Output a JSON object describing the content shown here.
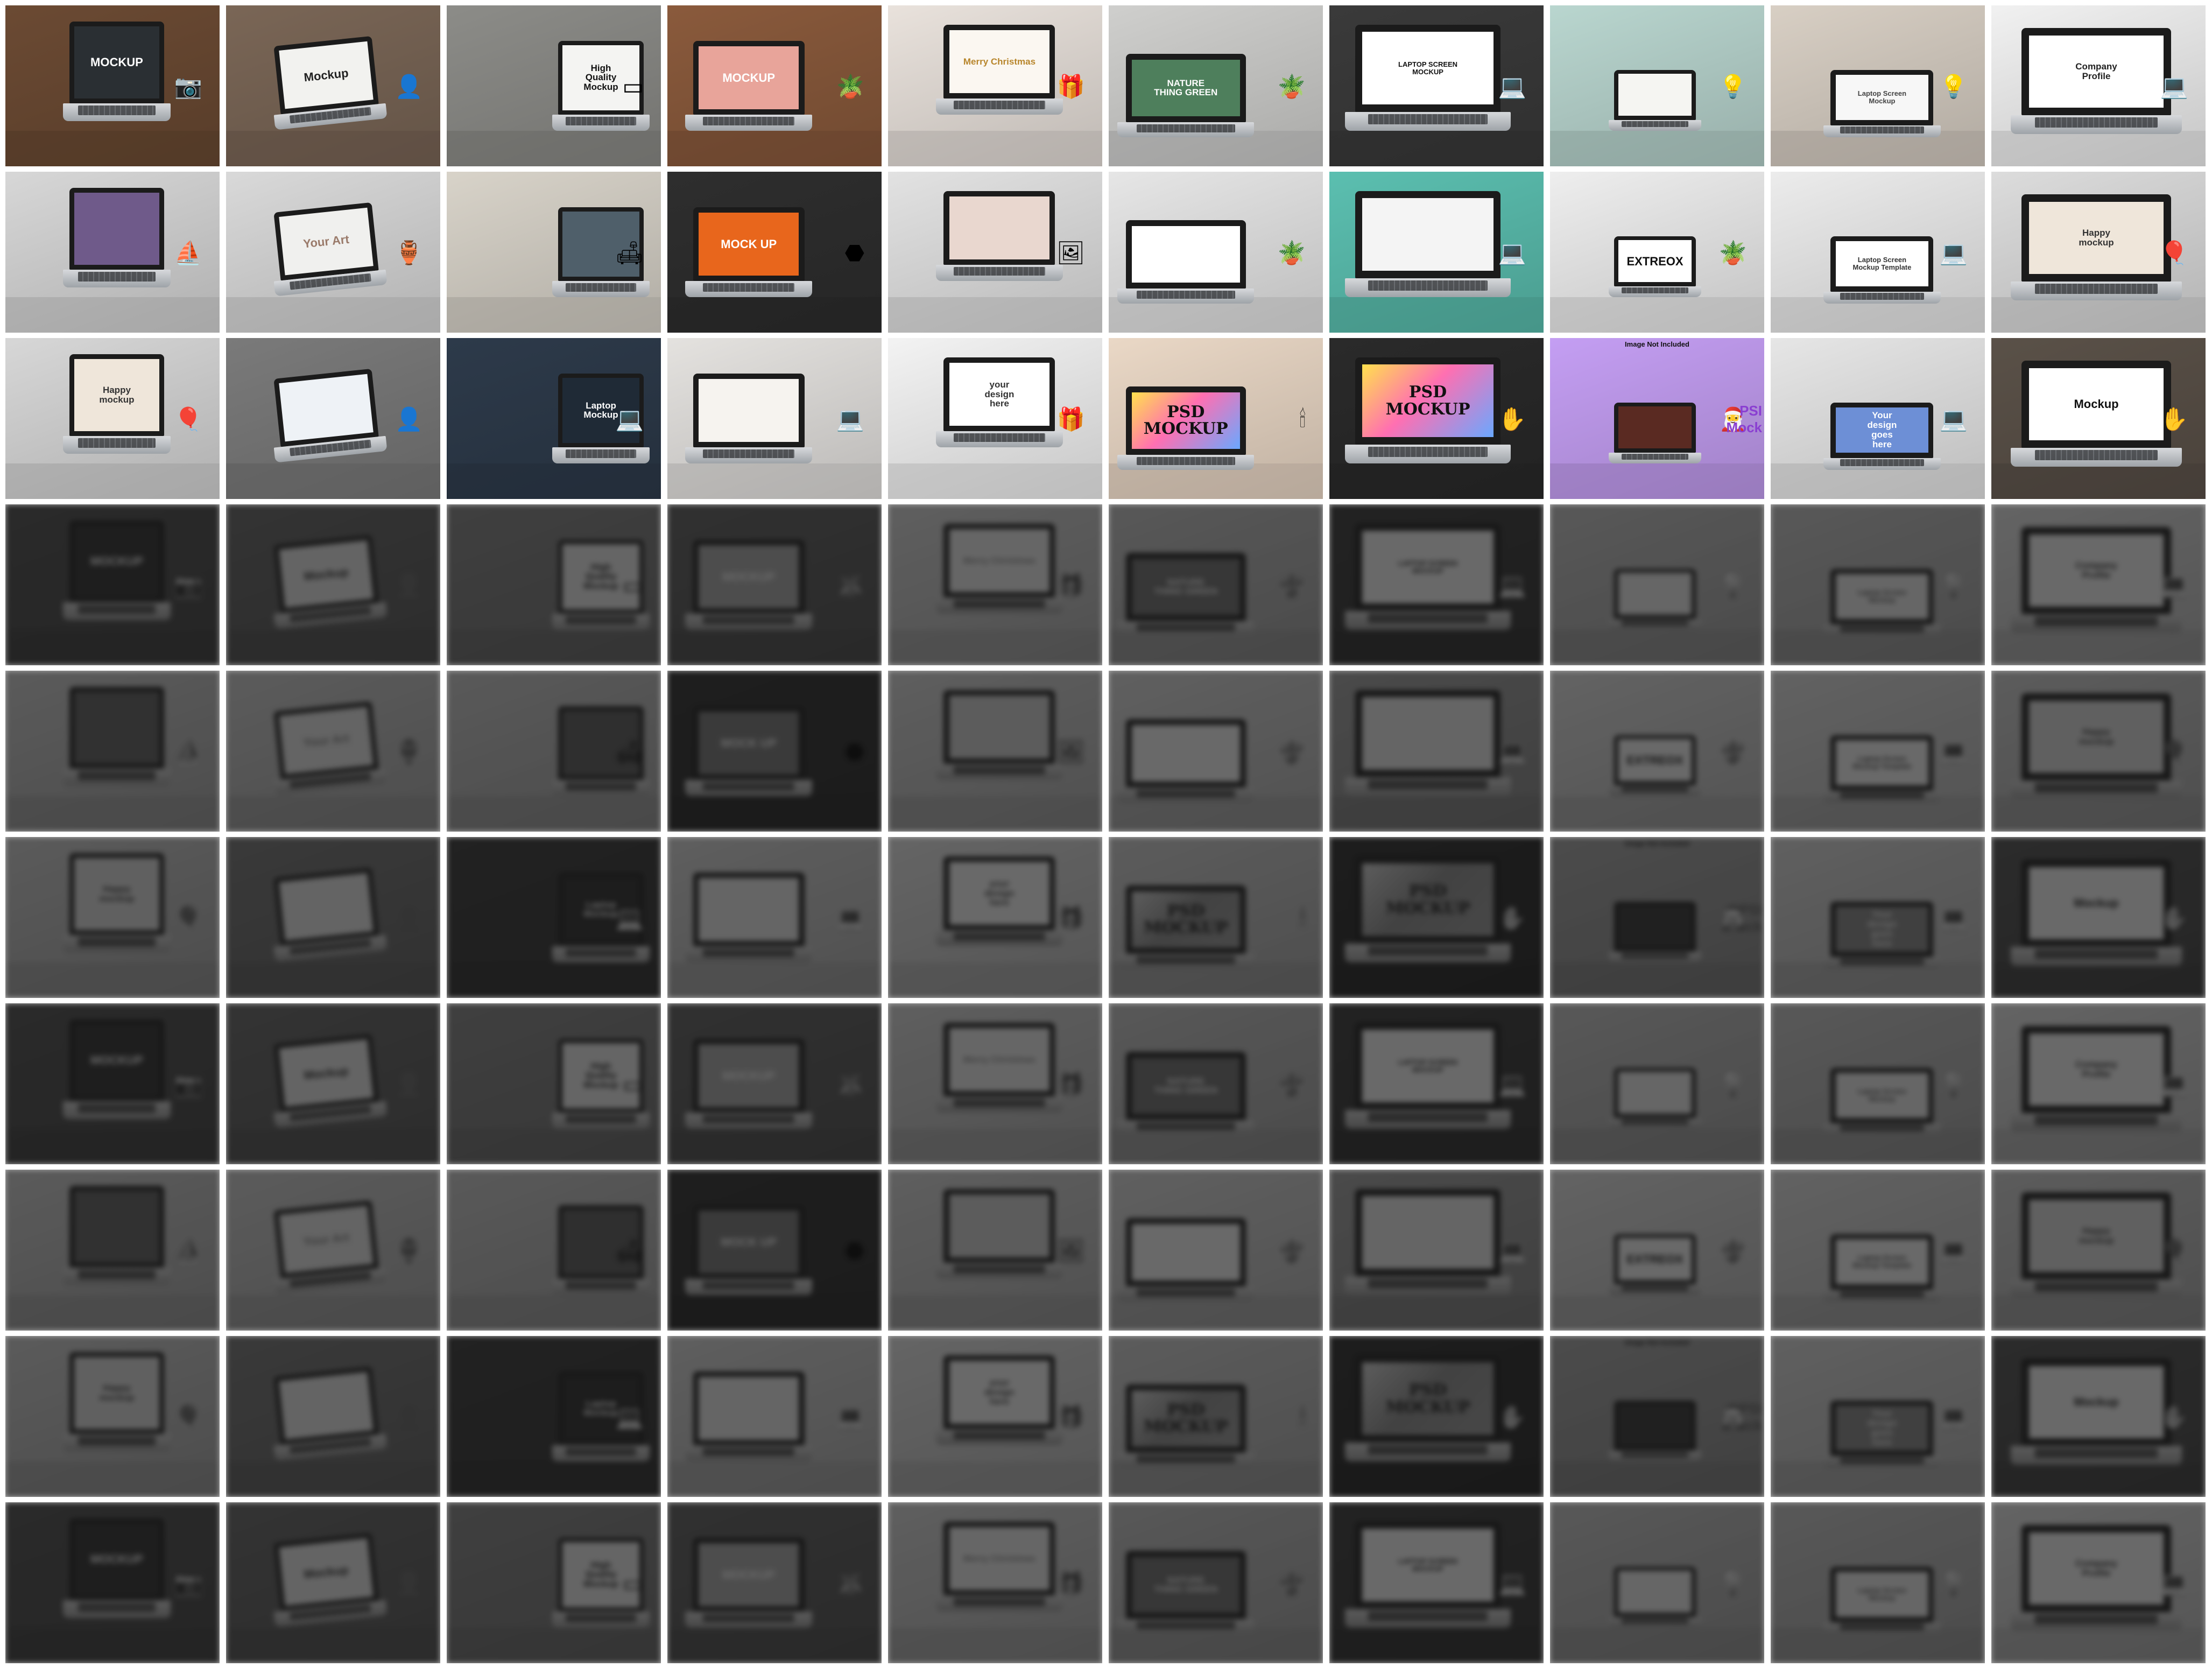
{
  "gallery": {
    "rows": 10,
    "columns": 10,
    "pattern_rows": [
      [
        {
          "id": "mockup-camera",
          "bg": "#6b4a33",
          "screen_bg": "#2a2f33",
          "text": "MOCKUP",
          "text_color": "#ffffff",
          "icon": "camera-icon"
        },
        {
          "id": "mockup-couch",
          "bg": "#7a6656",
          "screen_bg": "#f2f2ef",
          "text": "Mockup",
          "text_color": "#222222",
          "icon": "person-icon"
        },
        {
          "id": "high-quality-mockup",
          "bg": "#8c8c88",
          "screen_bg": "#f4f4f2",
          "text": "High\nQuality\nMockup",
          "text_color": "#111111",
          "icon": "tablet-icon"
        },
        {
          "id": "novel-mockup",
          "bg": "#8a5a3c",
          "screen_bg": "#e8a49a",
          "text": "MOCKUP",
          "text_color": "#ffffff",
          "icon": "plant-icon"
        },
        {
          "id": "merry-christmas",
          "bg": "#e9e2dc",
          "screen_bg": "#fbf7f1",
          "text": "Merry Christmas",
          "text_color": "#b8862c",
          "icon": "gift-icon"
        },
        {
          "id": "nature-thing-green",
          "bg": "#cfcfcd",
          "screen_bg": "#4e7f5c",
          "text": "NATURE\nTHING GREEN",
          "text_color": "#ffffff",
          "icon": "plant-icon"
        },
        {
          "id": "laptop-screen-mockup",
          "bg": "#3a3a3a",
          "screen_bg": "#ffffff",
          "text": "LAPTOP SCREEN\nMOCKUP",
          "text_color": "#111111",
          "icon": "laptop-icon"
        },
        {
          "id": "mint-desk",
          "bg": "#b9d6cf",
          "screen_bg": "#f5f5f2",
          "text": "",
          "text_color": "#333333",
          "icon": "lamp-icon"
        },
        {
          "id": "laptop-screen-mockup-desk",
          "bg": "#d8cfc4",
          "screen_bg": "#f7f7f7",
          "text": "Laptop Screen\nMockup",
          "text_color": "#444444",
          "icon": "lamp-icon"
        },
        {
          "id": "company-profile",
          "bg": "#f1f1f1",
          "screen_bg": "#ffffff",
          "text": "Company\nProfile",
          "text_color": "#222222",
          "icon": "laptop-icon"
        }
      ],
      [
        {
          "id": "sunset-screen",
          "bg": "#d7d7d7",
          "screen_bg": "#6f5a8a",
          "text": "",
          "text_color": "#ffffff",
          "icon": "boat-icon"
        },
        {
          "id": "your-art",
          "bg": "#d9d9d9",
          "screen_bg": "#f0f0ee",
          "text": "Your Art",
          "text_color": "#9a7a6a",
          "icon": "vase-icon"
        },
        {
          "id": "yellow-couch",
          "bg": "#d8d3c9",
          "screen_bg": "#4f5f6a",
          "text": "",
          "text_color": "#ffffff",
          "icon": "chair-icon"
        },
        {
          "id": "mock-up-rock",
          "bg": "#2e2e2e",
          "screen_bg": "#e8661c",
          "text": "MOCK UP",
          "text_color": "#ffffff",
          "icon": "rock-icon"
        },
        {
          "id": "photo-screen",
          "bg": "#e2e2e2",
          "screen_bg": "#e9d7cf",
          "text": "",
          "text_color": "#444444",
          "icon": "photo-icon"
        },
        {
          "id": "shadow-desk",
          "bg": "#e6e6e6",
          "screen_bg": "#ffffff",
          "text": "",
          "text_color": "#333333",
          "icon": "plant-icon"
        },
        {
          "id": "teal-duo",
          "bg": "#5bbfb0",
          "screen_bg": "#f4f4f4",
          "text": "",
          "text_color": "#333333",
          "icon": "laptop-icon"
        },
        {
          "id": "extreox",
          "bg": "#eeeeee",
          "screen_bg": "#ffffff",
          "text": "EXTREOX",
          "text_color": "#111111",
          "icon": "plant-icon"
        },
        {
          "id": "laptop-screen-template",
          "bg": "#ececec",
          "screen_bg": "#ffffff",
          "text": "Laptop Screen\nMockup Template",
          "text_color": "#333333",
          "icon": "laptop-icon"
        },
        {
          "id": "happy-mockup-1",
          "bg": "#dcdcdc",
          "screen_bg": "#efe6da",
          "text": "Happy\nmockup",
          "text_color": "#333333",
          "icon": "balloon-icon"
        }
      ],
      [
        {
          "id": "happy-mockup-2",
          "bg": "#d7d7d7",
          "screen_bg": "#efe6da",
          "text": "Happy\nmockup",
          "text_color": "#333333",
          "icon": "balloon-icon"
        },
        {
          "id": "lap-user",
          "bg": "#7a7a7a",
          "screen_bg": "#eef2f6",
          "text": "",
          "text_color": "#333333",
          "icon": "person-icon"
        },
        {
          "id": "laptop-mockup-dark",
          "bg": "#2d3a4a",
          "screen_bg": "#1f2a36",
          "text": "Laptop\nMockup",
          "text_color": "#ffffff",
          "icon": "laptop-icon"
        },
        {
          "id": "marble-desk",
          "bg": "#e4e2df",
          "screen_bg": "#f6f3ef",
          "text": "",
          "text_color": "#444444",
          "icon": "laptop-icon"
        },
        {
          "id": "your-design-here",
          "bg": "#f3f3f3",
          "screen_bg": "#ffffff",
          "text": "your\ndesign\nhere",
          "text_color": "#333333",
          "icon": "gift-icon"
        },
        {
          "id": "psd-mockup-candle",
          "bg": "#ead8c6",
          "screen_bg": "#7fb3ff",
          "text": "PSD\nMOCKUP",
          "text_color": "#111111",
          "icon": "candle-icon"
        },
        {
          "id": "psd-mockup-typing",
          "bg": "#2a2a2a",
          "screen_bg": "#ff7aa8",
          "text": "PSD\nMOCKUP",
          "text_color": "#111111",
          "icon": "hand-icon"
        },
        {
          "id": "image-not-included",
          "bg": "#c49ef3",
          "screen_bg": "#5a2a22",
          "text": "",
          "text_color": "#ffffff",
          "icon": "santa-icon",
          "caption": "Image Not Included",
          "side_text": "PSI\nMock"
        },
        {
          "id": "your-design-here-blue",
          "bg": "#e6e6e6",
          "screen_bg": "#6d8fd6",
          "text": "Your\ndesign\ngoes\nhere",
          "text_color": "#ffffff",
          "icon": "laptop-icon"
        },
        {
          "id": "mockup-lap-typing",
          "bg": "#5a5148",
          "screen_bg": "#ffffff",
          "text": "Mockup",
          "text_color": "#111111",
          "icon": "hand-icon"
        }
      ]
    ],
    "row_pattern_index": [
      0,
      1,
      2,
      0,
      1,
      2,
      0,
      1,
      2,
      0
    ],
    "row_faded": [
      false,
      false,
      false,
      true,
      true,
      true,
      true,
      true,
      true,
      true
    ]
  }
}
